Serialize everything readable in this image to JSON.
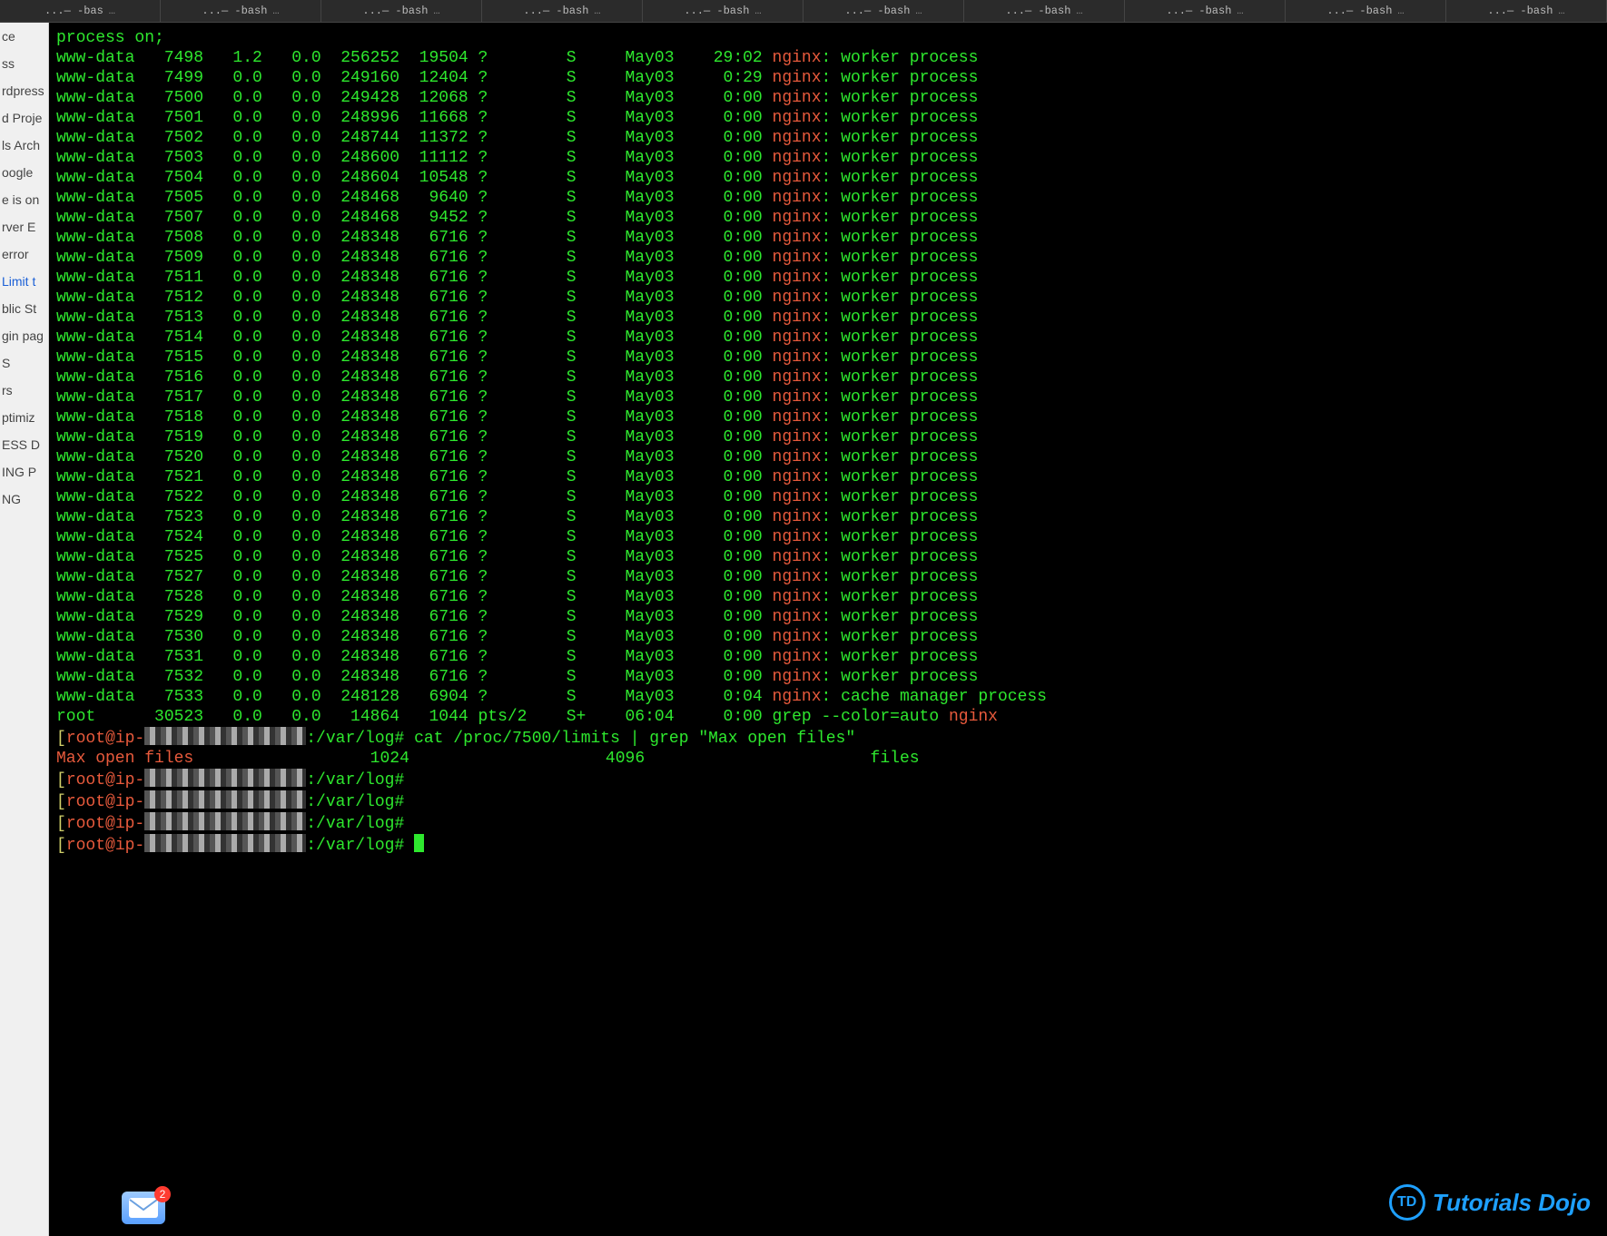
{
  "tabs": [
    {
      "label": "...— -bas"
    },
    {
      "label": "...— -bash"
    },
    {
      "label": "...— -bash"
    },
    {
      "label": "...— -bash"
    },
    {
      "label": "...— -bash"
    },
    {
      "label": "...— -bash"
    },
    {
      "label": "...— -bash"
    },
    {
      "label": "...— -bash"
    },
    {
      "label": "...— -bash"
    },
    {
      "label": "...— -bash"
    }
  ],
  "sidebar_items": [
    "ce",
    "ss",
    "rdpress",
    "d Proje",
    "ls Arch",
    "oogle",
    "e is on",
    "rver E",
    "error",
    "Limit t",
    "blic St",
    "gin pag",
    "S",
    "rs",
    "ptimiz",
    "ESS  D",
    "ING  P",
    "NG"
  ],
  "sidebar_blue_index": 9,
  "first_line": "process on;",
  "processes": [
    {
      "user": "www-data",
      "pid": "7498",
      "cpu": "1.2",
      "mem": "0.0",
      "vsz": "256252",
      "rss": "19504",
      "tty": "?",
      "stat": "S",
      "start": "May03",
      "time": "29:02",
      "cmd_hi": "nginx",
      "cmd_rest": ": worker process"
    },
    {
      "user": "www-data",
      "pid": "7499",
      "cpu": "0.0",
      "mem": "0.0",
      "vsz": "249160",
      "rss": "12404",
      "tty": "?",
      "stat": "S",
      "start": "May03",
      "time": "0:29",
      "cmd_hi": "nginx",
      "cmd_rest": ": worker process"
    },
    {
      "user": "www-data",
      "pid": "7500",
      "cpu": "0.0",
      "mem": "0.0",
      "vsz": "249428",
      "rss": "12068",
      "tty": "?",
      "stat": "S",
      "start": "May03",
      "time": "0:00",
      "cmd_hi": "nginx",
      "cmd_rest": ": worker process"
    },
    {
      "user": "www-data",
      "pid": "7501",
      "cpu": "0.0",
      "mem": "0.0",
      "vsz": "248996",
      "rss": "11668",
      "tty": "?",
      "stat": "S",
      "start": "May03",
      "time": "0:00",
      "cmd_hi": "nginx",
      "cmd_rest": ": worker process"
    },
    {
      "user": "www-data",
      "pid": "7502",
      "cpu": "0.0",
      "mem": "0.0",
      "vsz": "248744",
      "rss": "11372",
      "tty": "?",
      "stat": "S",
      "start": "May03",
      "time": "0:00",
      "cmd_hi": "nginx",
      "cmd_rest": ": worker process"
    },
    {
      "user": "www-data",
      "pid": "7503",
      "cpu": "0.0",
      "mem": "0.0",
      "vsz": "248600",
      "rss": "11112",
      "tty": "?",
      "stat": "S",
      "start": "May03",
      "time": "0:00",
      "cmd_hi": "nginx",
      "cmd_rest": ": worker process"
    },
    {
      "user": "www-data",
      "pid": "7504",
      "cpu": "0.0",
      "mem": "0.0",
      "vsz": "248604",
      "rss": "10548",
      "tty": "?",
      "stat": "S",
      "start": "May03",
      "time": "0:00",
      "cmd_hi": "nginx",
      "cmd_rest": ": worker process"
    },
    {
      "user": "www-data",
      "pid": "7505",
      "cpu": "0.0",
      "mem": "0.0",
      "vsz": "248468",
      "rss": "9640",
      "tty": "?",
      "stat": "S",
      "start": "May03",
      "time": "0:00",
      "cmd_hi": "nginx",
      "cmd_rest": ": worker process"
    },
    {
      "user": "www-data",
      "pid": "7507",
      "cpu": "0.0",
      "mem": "0.0",
      "vsz": "248468",
      "rss": "9452",
      "tty": "?",
      "stat": "S",
      "start": "May03",
      "time": "0:00",
      "cmd_hi": "nginx",
      "cmd_rest": ": worker process"
    },
    {
      "user": "www-data",
      "pid": "7508",
      "cpu": "0.0",
      "mem": "0.0",
      "vsz": "248348",
      "rss": "6716",
      "tty": "?",
      "stat": "S",
      "start": "May03",
      "time": "0:00",
      "cmd_hi": "nginx",
      "cmd_rest": ": worker process"
    },
    {
      "user": "www-data",
      "pid": "7509",
      "cpu": "0.0",
      "mem": "0.0",
      "vsz": "248348",
      "rss": "6716",
      "tty": "?",
      "stat": "S",
      "start": "May03",
      "time": "0:00",
      "cmd_hi": "nginx",
      "cmd_rest": ": worker process"
    },
    {
      "user": "www-data",
      "pid": "7511",
      "cpu": "0.0",
      "mem": "0.0",
      "vsz": "248348",
      "rss": "6716",
      "tty": "?",
      "stat": "S",
      "start": "May03",
      "time": "0:00",
      "cmd_hi": "nginx",
      "cmd_rest": ": worker process"
    },
    {
      "user": "www-data",
      "pid": "7512",
      "cpu": "0.0",
      "mem": "0.0",
      "vsz": "248348",
      "rss": "6716",
      "tty": "?",
      "stat": "S",
      "start": "May03",
      "time": "0:00",
      "cmd_hi": "nginx",
      "cmd_rest": ": worker process"
    },
    {
      "user": "www-data",
      "pid": "7513",
      "cpu": "0.0",
      "mem": "0.0",
      "vsz": "248348",
      "rss": "6716",
      "tty": "?",
      "stat": "S",
      "start": "May03",
      "time": "0:00",
      "cmd_hi": "nginx",
      "cmd_rest": ": worker process"
    },
    {
      "user": "www-data",
      "pid": "7514",
      "cpu": "0.0",
      "mem": "0.0",
      "vsz": "248348",
      "rss": "6716",
      "tty": "?",
      "stat": "S",
      "start": "May03",
      "time": "0:00",
      "cmd_hi": "nginx",
      "cmd_rest": ": worker process"
    },
    {
      "user": "www-data",
      "pid": "7515",
      "cpu": "0.0",
      "mem": "0.0",
      "vsz": "248348",
      "rss": "6716",
      "tty": "?",
      "stat": "S",
      "start": "May03",
      "time": "0:00",
      "cmd_hi": "nginx",
      "cmd_rest": ": worker process"
    },
    {
      "user": "www-data",
      "pid": "7516",
      "cpu": "0.0",
      "mem": "0.0",
      "vsz": "248348",
      "rss": "6716",
      "tty": "?",
      "stat": "S",
      "start": "May03",
      "time": "0:00",
      "cmd_hi": "nginx",
      "cmd_rest": ": worker process"
    },
    {
      "user": "www-data",
      "pid": "7517",
      "cpu": "0.0",
      "mem": "0.0",
      "vsz": "248348",
      "rss": "6716",
      "tty": "?",
      "stat": "S",
      "start": "May03",
      "time": "0:00",
      "cmd_hi": "nginx",
      "cmd_rest": ": worker process"
    },
    {
      "user": "www-data",
      "pid": "7518",
      "cpu": "0.0",
      "mem": "0.0",
      "vsz": "248348",
      "rss": "6716",
      "tty": "?",
      "stat": "S",
      "start": "May03",
      "time": "0:00",
      "cmd_hi": "nginx",
      "cmd_rest": ": worker process"
    },
    {
      "user": "www-data",
      "pid": "7519",
      "cpu": "0.0",
      "mem": "0.0",
      "vsz": "248348",
      "rss": "6716",
      "tty": "?",
      "stat": "S",
      "start": "May03",
      "time": "0:00",
      "cmd_hi": "nginx",
      "cmd_rest": ": worker process"
    },
    {
      "user": "www-data",
      "pid": "7520",
      "cpu": "0.0",
      "mem": "0.0",
      "vsz": "248348",
      "rss": "6716",
      "tty": "?",
      "stat": "S",
      "start": "May03",
      "time": "0:00",
      "cmd_hi": "nginx",
      "cmd_rest": ": worker process"
    },
    {
      "user": "www-data",
      "pid": "7521",
      "cpu": "0.0",
      "mem": "0.0",
      "vsz": "248348",
      "rss": "6716",
      "tty": "?",
      "stat": "S",
      "start": "May03",
      "time": "0:00",
      "cmd_hi": "nginx",
      "cmd_rest": ": worker process"
    },
    {
      "user": "www-data",
      "pid": "7522",
      "cpu": "0.0",
      "mem": "0.0",
      "vsz": "248348",
      "rss": "6716",
      "tty": "?",
      "stat": "S",
      "start": "May03",
      "time": "0:00",
      "cmd_hi": "nginx",
      "cmd_rest": ": worker process"
    },
    {
      "user": "www-data",
      "pid": "7523",
      "cpu": "0.0",
      "mem": "0.0",
      "vsz": "248348",
      "rss": "6716",
      "tty": "?",
      "stat": "S",
      "start": "May03",
      "time": "0:00",
      "cmd_hi": "nginx",
      "cmd_rest": ": worker process"
    },
    {
      "user": "www-data",
      "pid": "7524",
      "cpu": "0.0",
      "mem": "0.0",
      "vsz": "248348",
      "rss": "6716",
      "tty": "?",
      "stat": "S",
      "start": "May03",
      "time": "0:00",
      "cmd_hi": "nginx",
      "cmd_rest": ": worker process"
    },
    {
      "user": "www-data",
      "pid": "7525",
      "cpu": "0.0",
      "mem": "0.0",
      "vsz": "248348",
      "rss": "6716",
      "tty": "?",
      "stat": "S",
      "start": "May03",
      "time": "0:00",
      "cmd_hi": "nginx",
      "cmd_rest": ": worker process"
    },
    {
      "user": "www-data",
      "pid": "7527",
      "cpu": "0.0",
      "mem": "0.0",
      "vsz": "248348",
      "rss": "6716",
      "tty": "?",
      "stat": "S",
      "start": "May03",
      "time": "0:00",
      "cmd_hi": "nginx",
      "cmd_rest": ": worker process"
    },
    {
      "user": "www-data",
      "pid": "7528",
      "cpu": "0.0",
      "mem": "0.0",
      "vsz": "248348",
      "rss": "6716",
      "tty": "?",
      "stat": "S",
      "start": "May03",
      "time": "0:00",
      "cmd_hi": "nginx",
      "cmd_rest": ": worker process"
    },
    {
      "user": "www-data",
      "pid": "7529",
      "cpu": "0.0",
      "mem": "0.0",
      "vsz": "248348",
      "rss": "6716",
      "tty": "?",
      "stat": "S",
      "start": "May03",
      "time": "0:00",
      "cmd_hi": "nginx",
      "cmd_rest": ": worker process"
    },
    {
      "user": "www-data",
      "pid": "7530",
      "cpu": "0.0",
      "mem": "0.0",
      "vsz": "248348",
      "rss": "6716",
      "tty": "?",
      "stat": "S",
      "start": "May03",
      "time": "0:00",
      "cmd_hi": "nginx",
      "cmd_rest": ": worker process"
    },
    {
      "user": "www-data",
      "pid": "7531",
      "cpu": "0.0",
      "mem": "0.0",
      "vsz": "248348",
      "rss": "6716",
      "tty": "?",
      "stat": "S",
      "start": "May03",
      "time": "0:00",
      "cmd_hi": "nginx",
      "cmd_rest": ": worker process"
    },
    {
      "user": "www-data",
      "pid": "7532",
      "cpu": "0.0",
      "mem": "0.0",
      "vsz": "248348",
      "rss": "6716",
      "tty": "?",
      "stat": "S",
      "start": "May03",
      "time": "0:00",
      "cmd_hi": "nginx",
      "cmd_rest": ": worker process"
    },
    {
      "user": "www-data",
      "pid": "7533",
      "cpu": "0.0",
      "mem": "0.0",
      "vsz": "248128",
      "rss": "6904",
      "tty": "?",
      "stat": "S",
      "start": "May03",
      "time": "0:04",
      "cmd_hi": "nginx",
      "cmd_rest": ": cache manager process"
    },
    {
      "user": "root",
      "pid": "30523",
      "cpu": "0.0",
      "mem": "0.0",
      "vsz": "14864",
      "rss": "1044",
      "tty": "pts/2",
      "stat": "S+",
      "start": "06:04",
      "time": "0:00",
      "cmd_hi": "nginx",
      "cmd_rest": "",
      "grep_prefix": "grep --color=auto "
    }
  ],
  "prompt_user_host": "root@ip-",
  "prompt_path": ":/var/log#",
  "cat_command": " cat /proc/7500/limits | grep \"Max open files\"",
  "limits_output": {
    "label": "Max open files",
    "soft": "1024",
    "hard": "4096",
    "unit": "files"
  },
  "empty_prompts_count": 4,
  "mail_badge_count": "2",
  "logo_text": "Tutorials Dojo",
  "logo_mark": "TD"
}
